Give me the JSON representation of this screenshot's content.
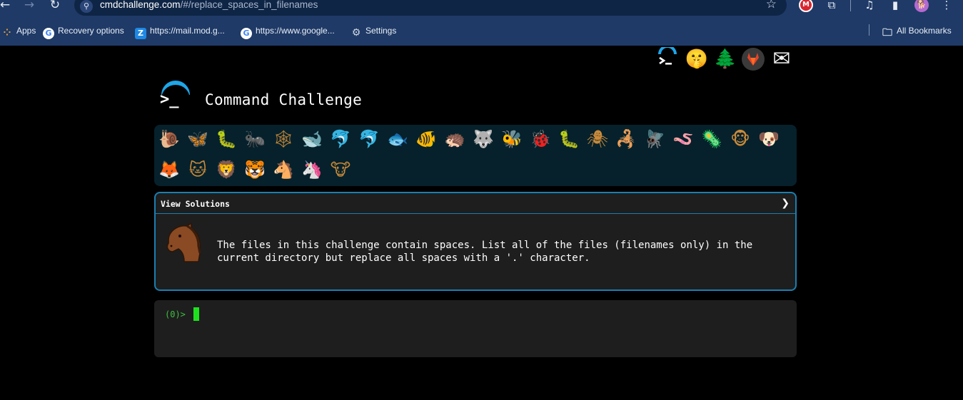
{
  "browser": {
    "back_icon": "←",
    "forward_icon": "→",
    "reload_icon": "↻",
    "site_info_icon": "⚲",
    "url_host": "cmdchallenge.com",
    "url_path": "/#/replace_spaces_in_filenames",
    "bookmark_star_icon": "☆",
    "extensions": [
      "M",
      "⧉",
      "♫",
      "▮",
      "🐕",
      "⋮"
    ],
    "bookmarks": [
      {
        "icon": "⁘",
        "label": "Apps"
      },
      {
        "icon": "G",
        "label": "Recovery options"
      },
      {
        "icon": "Z",
        "label": "https://mail.mod.g..."
      },
      {
        "icon": "G",
        "label": "https://www.google..."
      },
      {
        "icon": "⚙",
        "label": "Settings"
      }
    ],
    "all_bookmarks_icon": "🗀",
    "all_bookmarks_label": "All Bookmarks"
  },
  "header_links": [
    {
      "name": "cmdchallenge-logo-link",
      "icon": "cmd-icon"
    },
    {
      "name": "shush-emoji-link",
      "icon": "🤫"
    },
    {
      "name": "tree-link",
      "icon": "🌲"
    },
    {
      "name": "gitlab-link",
      "icon": "gitlab-icon"
    },
    {
      "name": "email-link",
      "icon": "✉"
    }
  ],
  "logo_prompt": ">_",
  "title": "Command Challenge",
  "animals": [
    "🐌",
    "🦋",
    "🐛",
    "🐜",
    "🕸",
    "🐋",
    "🐬",
    "🐬",
    "🐟",
    "🐠",
    "🦔",
    "🐺",
    "🐝",
    "🐞",
    "🐛",
    "🕷",
    "🦂",
    "🪰",
    "🪱",
    "🦠",
    "🐵",
    "🐶",
    "🦊",
    "🐱",
    "🦁",
    "🐯",
    "🐴",
    "🦄",
    "🐮"
  ],
  "panel": {
    "header_label": "View Solutions",
    "chevron": "❯",
    "challenge_text": "The files in this challenge contain spaces. List all of the files (filenames only) in the current directory but replace all spaces with a '.' character."
  },
  "terminal": {
    "prompt": "(0)>"
  },
  "colors": {
    "accent": "#1a7fb0",
    "logo_arc": "#1ea6e8",
    "prompt_green": "#3fbf3f",
    "cursor_green": "#1fe01f"
  }
}
